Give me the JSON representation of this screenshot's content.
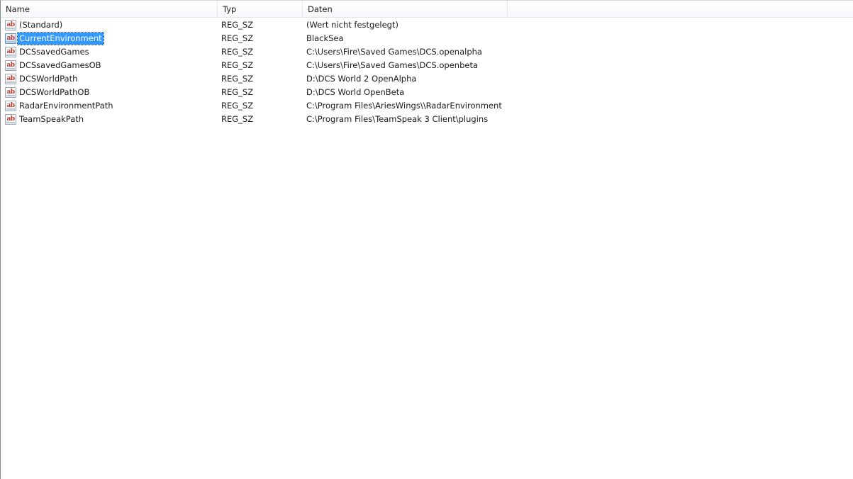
{
  "columns": {
    "name": "Name",
    "typ": "Typ",
    "daten": "Daten"
  },
  "icon": "string-value-icon",
  "icon_glyph": "ab",
  "selected_index": 1,
  "rows": [
    {
      "name": "(Standard)",
      "typ": "REG_SZ",
      "daten": "(Wert nicht festgelegt)"
    },
    {
      "name": "CurrentEnvironment",
      "typ": "REG_SZ",
      "daten": "BlackSea"
    },
    {
      "name": "DCSsavedGames",
      "typ": "REG_SZ",
      "daten": "C:\\Users\\Fire\\Saved Games\\DCS.openalpha"
    },
    {
      "name": "DCSsavedGamesOB",
      "typ": "REG_SZ",
      "daten": "C:\\Users\\Fire\\Saved Games\\DCS.openbeta"
    },
    {
      "name": "DCSWorldPath",
      "typ": "REG_SZ",
      "daten": "D:\\DCS World 2 OpenAlpha"
    },
    {
      "name": "DCSWorldPathOB",
      "typ": "REG_SZ",
      "daten": "D:\\DCS World OpenBeta"
    },
    {
      "name": "RadarEnvironmentPath",
      "typ": "REG_SZ",
      "daten": "C:\\Program Files\\AriesWings\\\\RadarEnvironment"
    },
    {
      "name": "TeamSpeakPath",
      "typ": "REG_SZ",
      "daten": "C:\\Program Files\\TeamSpeak 3 Client\\plugins"
    }
  ]
}
